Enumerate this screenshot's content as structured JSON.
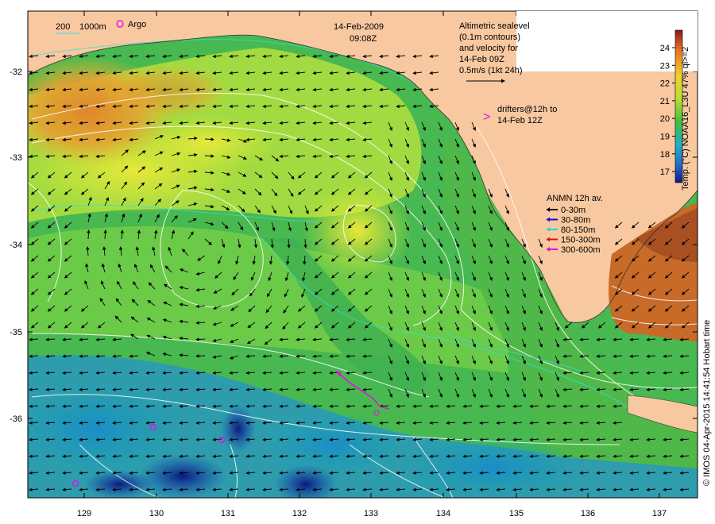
{
  "header": {
    "date": "14-Feb-2009",
    "time": "09:08Z"
  },
  "scale_bar": {
    "label_a": "200",
    "label_b": "1000m",
    "argo_label": "Argo"
  },
  "altimetry_note": {
    "lines": [
      "Altimetric sealevel",
      "(0.1m contours)",
      "and velocity for",
      "14-Feb 09Z",
      "0.5m/s (1kt 24h)"
    ]
  },
  "drifters_note": {
    "lines": [
      "drifters@12h to",
      "14-Feb 12Z"
    ]
  },
  "anmn_legend": {
    "title": "ANMN 12h av.",
    "items": [
      {
        "label": "0-30m",
        "color": "#000000"
      },
      {
        "label": "30-80m",
        "color": "#1010e0"
      },
      {
        "label": "80-150m",
        "color": "#20d8d8"
      },
      {
        "label": "150-300m",
        "color": "#e01010"
      },
      {
        "label": "300-600m",
        "color": "#e010e0"
      }
    ]
  },
  "colorbar": {
    "label": "Temp. (°C) NOAA16_L3U 47% ql>=2",
    "ticks": [
      "24",
      "23",
      "22",
      "21",
      "20",
      "19",
      "18",
      "17"
    ]
  },
  "copyright": "© IMOS 04-Apr-2015 14:41:54 Hobart time",
  "axes": {
    "x_ticks": [
      "129",
      "130",
      "131",
      "132",
      "133",
      "134",
      "135",
      "136",
      "137"
    ],
    "y_ticks": [
      "-32",
      "-33",
      "-34",
      "-35",
      "-36"
    ]
  },
  "colors": {
    "land": "#f8c8a0",
    "warm": "#e08a28",
    "mid": "#8ed848",
    "cool": "#1f9aa8",
    "cold": "#162e9a",
    "argo": "#e010e0"
  },
  "icons": [
    "argo-float-icon",
    "velocity-arrow-icon",
    "drifter-marker-icon"
  ]
}
